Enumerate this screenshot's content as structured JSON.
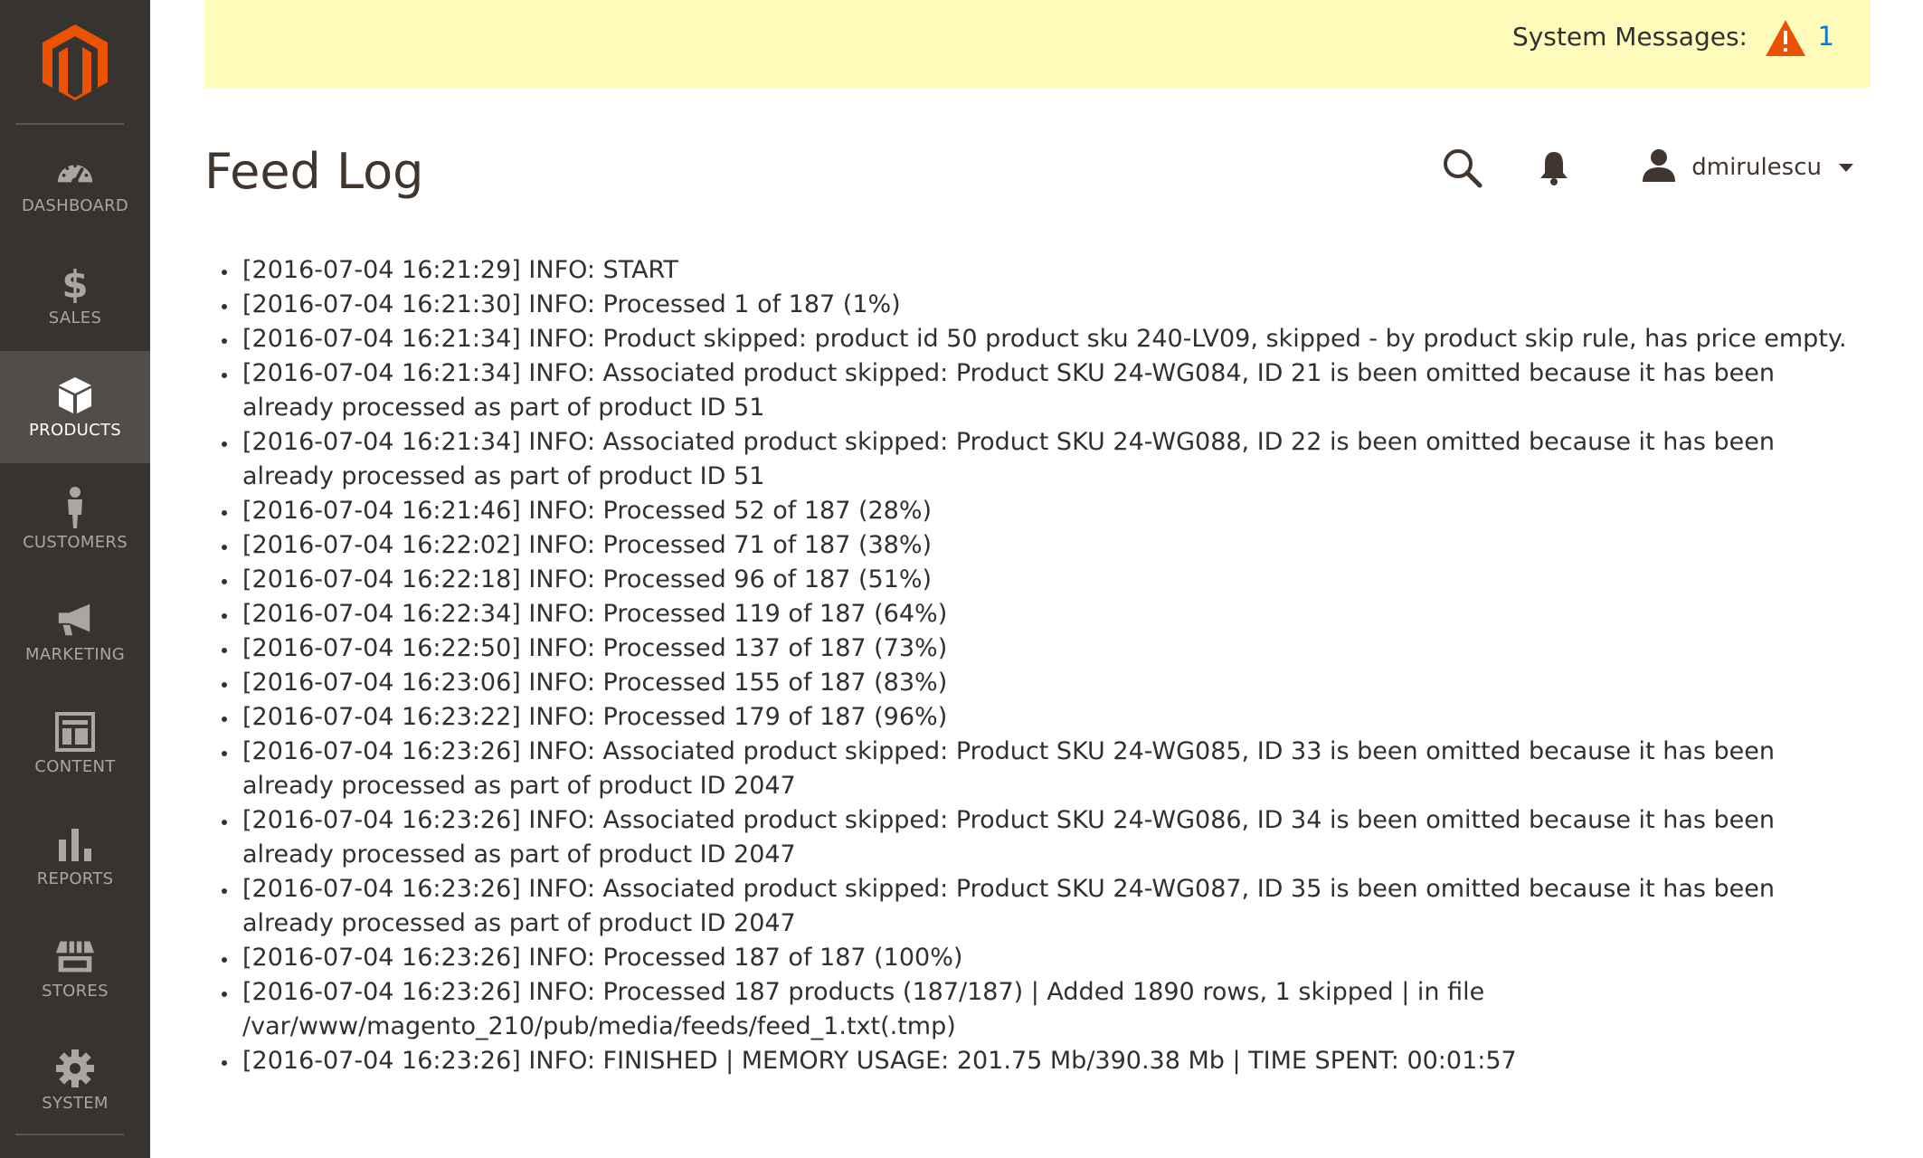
{
  "system_messages": {
    "label": "System Messages:",
    "count": "1",
    "icon": "warning-icon",
    "icon_color": "#eb5202"
  },
  "sidebar": {
    "logo_icon": "magento-logo-icon",
    "logo_color": "#eb5202",
    "items": [
      {
        "label": "DASHBOARD",
        "icon": "dashboard-icon",
        "active": false
      },
      {
        "label": "SALES",
        "icon": "dollar-icon",
        "active": false
      },
      {
        "label": "PRODUCTS",
        "icon": "cube-icon",
        "active": true
      },
      {
        "label": "CUSTOMERS",
        "icon": "person-icon",
        "active": false
      },
      {
        "label": "MARKETING",
        "icon": "megaphone-icon",
        "active": false
      },
      {
        "label": "CONTENT",
        "icon": "layout-icon",
        "active": false
      },
      {
        "label": "REPORTS",
        "icon": "bar-chart-icon",
        "active": false
      },
      {
        "label": "STORES",
        "icon": "storefront-icon",
        "active": false
      },
      {
        "label": "SYSTEM",
        "icon": "gear-icon",
        "active": false
      }
    ]
  },
  "header": {
    "title": "Feed Log",
    "search_icon": "search-icon",
    "notifications_icon": "bell-icon",
    "user": {
      "name": "dmirulescu",
      "icon": "user-icon"
    }
  },
  "log": {
    "entries": [
      "[2016-07-04 16:21:29] INFO: START",
      "[2016-07-04 16:21:30] INFO: Processed 1 of 187 (1%)",
      "[2016-07-04 16:21:34] INFO: Product skipped: product id 50 product sku 240-LV09, skipped - by product skip rule, has price empty.",
      "[2016-07-04 16:21:34] INFO: Associated product skipped: Product SKU 24-WG084, ID 21 is been omitted because it has been already processed as part of product ID 51",
      "[2016-07-04 16:21:34] INFO: Associated product skipped: Product SKU 24-WG088, ID 22 is been omitted because it has been already processed as part of product ID 51",
      "[2016-07-04 16:21:46] INFO: Processed 52 of 187 (28%)",
      "[2016-07-04 16:22:02] INFO: Processed 71 of 187 (38%)",
      "[2016-07-04 16:22:18] INFO: Processed 96 of 187 (51%)",
      "[2016-07-04 16:22:34] INFO: Processed 119 of 187 (64%)",
      "[2016-07-04 16:22:50] INFO: Processed 137 of 187 (73%)",
      "[2016-07-04 16:23:06] INFO: Processed 155 of 187 (83%)",
      "[2016-07-04 16:23:22] INFO: Processed 179 of 187 (96%)",
      "[2016-07-04 16:23:26] INFO: Associated product skipped: Product SKU 24-WG085, ID 33 is been omitted because it has been already processed as part of product ID 2047",
      "[2016-07-04 16:23:26] INFO: Associated product skipped: Product SKU 24-WG086, ID 34 is been omitted because it has been already processed as part of product ID 2047",
      "[2016-07-04 16:23:26] INFO: Associated product skipped: Product SKU 24-WG087, ID 35 is been omitted because it has been already processed as part of product ID 2047",
      "[2016-07-04 16:23:26] INFO: Processed 187 of 187 (100%)",
      "[2016-07-04 16:23:26] INFO: Processed 187 products (187/187) | Added 1890 rows, 1 skipped | in file /var/www/magento_210/pub/media/feeds/feed_1.txt(.tmp)",
      "[2016-07-04 16:23:26] INFO: FINISHED | MEMORY USAGE: 201.75 Mb/390.38 Mb | TIME SPENT: 00:01:57"
    ]
  }
}
